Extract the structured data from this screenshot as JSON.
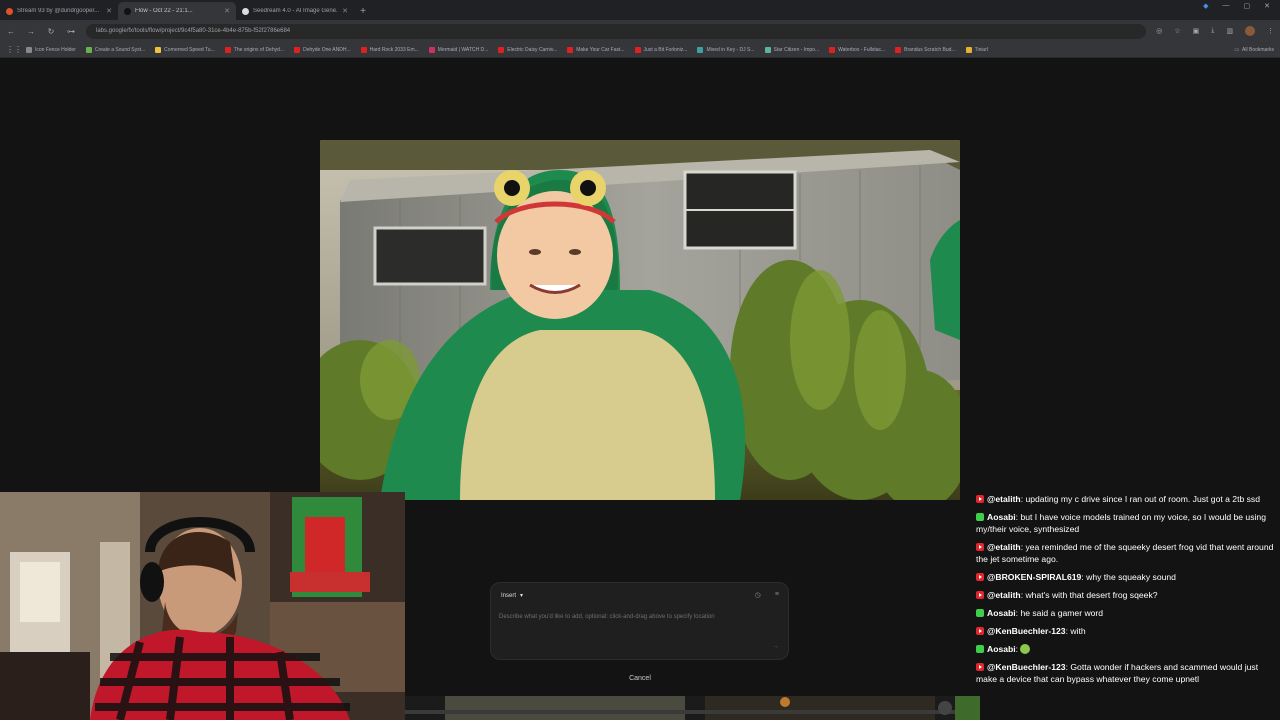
{
  "browser": {
    "tabs": [
      {
        "title": "Stream 93 by @dundrgooper...",
        "favicon_color": "#e0522b",
        "active": false
      },
      {
        "title": "Flow - Oct 22 - 21:1...",
        "favicon_color": "#111111",
        "active": true
      },
      {
        "title": "Seedream 4.0 - AI Image Gene...",
        "favicon_color": "#dddddd",
        "active": false
      }
    ],
    "url": "labs.google/fx/tools/flow/project/9c4f5a80-31ce-4b4e-875b-f52f2786e684",
    "bookmarks": [
      {
        "label": "Icon Fence Holder",
        "color": "#888888"
      },
      {
        "label": "Create a Sound Syst...",
        "color": "#6ab04c"
      },
      {
        "label": "Cornerned Speed Tu...",
        "color": "#f0c040"
      },
      {
        "label": "The origins of Dehyd...",
        "color": "#e02020"
      },
      {
        "label": "Dehyde One ANDH...",
        "color": "#e02020"
      },
      {
        "label": "Hard Rock 2033 Em...",
        "color": "#e02020"
      },
      {
        "label": "Mermaid | WATCH D...",
        "color": "#d03060"
      },
      {
        "label": "Electric Daisy Carniv...",
        "color": "#e02020"
      },
      {
        "label": "Make Your Car Fast...",
        "color": "#e02020"
      },
      {
        "label": "Just a Bit Forloniz...",
        "color": "#e02020"
      },
      {
        "label": "Mixed in Key - DJ S...",
        "color": "#3aa3a0"
      },
      {
        "label": "Star Citizen - Impo...",
        "color": "#5ab4a0"
      },
      {
        "label": "Waterbox - Fullstac...",
        "color": "#e02020"
      },
      {
        "label": "Brandus Scratch Bud...",
        "color": "#e02020"
      },
      {
        "label": "Tiniurl",
        "color": "#e8b030"
      }
    ],
    "all_bookmarks_label": "All Bookmarks"
  },
  "composer": {
    "mode_label": "Insert",
    "placeholder": "Describe what you'd like to add, optional: click-and-drag above to specify location",
    "cancel_label": "Cancel"
  },
  "chat": {
    "messages": [
      {
        "platform": "youtube",
        "user": "@etalith",
        "text": "updating my c drive since I ran out of room. Just got a 2tb ssd"
      },
      {
        "platform": "kick",
        "user": "Aosabi",
        "text": "but I have voice models trained on my voice, so I would be using my/their voice, synthesized"
      },
      {
        "platform": "youtube",
        "user": "@etalith",
        "text": "yea reminded me of the squeeky desert frog vid that went around the jet sometime ago."
      },
      {
        "platform": "youtube",
        "user": "@BROKEN-SPIRAL619",
        "text": "why the squeaky sound"
      },
      {
        "platform": "youtube",
        "user": "@etalith",
        "text": "what's with that desert frog sqeek?"
      },
      {
        "platform": "kick",
        "user": "Aosabi",
        "text": "he said a gamer word"
      },
      {
        "platform": "youtube",
        "user": "@KenBuechler-123",
        "text": "with"
      },
      {
        "platform": "kick",
        "user": "Aosabi",
        "text": ""
      },
      {
        "platform": "youtube",
        "user": "@KenBuechler-123",
        "text": "Gotta wonder if hackers and scammed would just make a device that can bypass whatever they come upnetl"
      }
    ]
  }
}
